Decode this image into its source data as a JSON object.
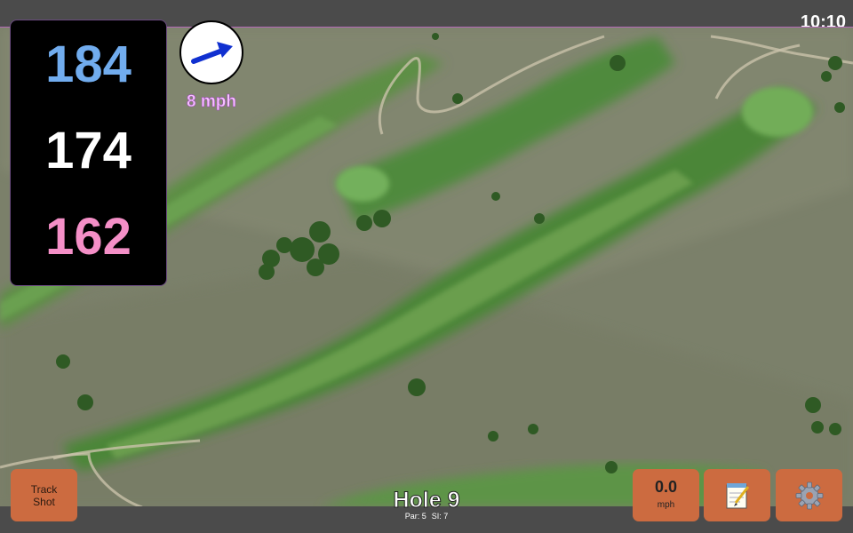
{
  "status_bar": {
    "time": "10:10"
  },
  "distances": {
    "back": "184",
    "middle": "174",
    "front": "162"
  },
  "wind": {
    "speed_label": "8 mph",
    "direction_icon": "wind-arrow-icon",
    "arrow_color": "#1030d0"
  },
  "buttons": {
    "track_shot_label": "Track Shot",
    "wind_value": "0.0",
    "wind_unit": "mph",
    "notes_icon": "notepad-icon",
    "settings_icon": "gear-icon",
    "color": "#cc6b40"
  },
  "hole": {
    "title": "Hole 9",
    "par": "Par: 5",
    "stroke_index": "SI: 7"
  },
  "colors": {
    "back": "#71acee",
    "middle": "#ffffff",
    "front": "#f48fc7",
    "wind_label": "#f6c2ff"
  }
}
